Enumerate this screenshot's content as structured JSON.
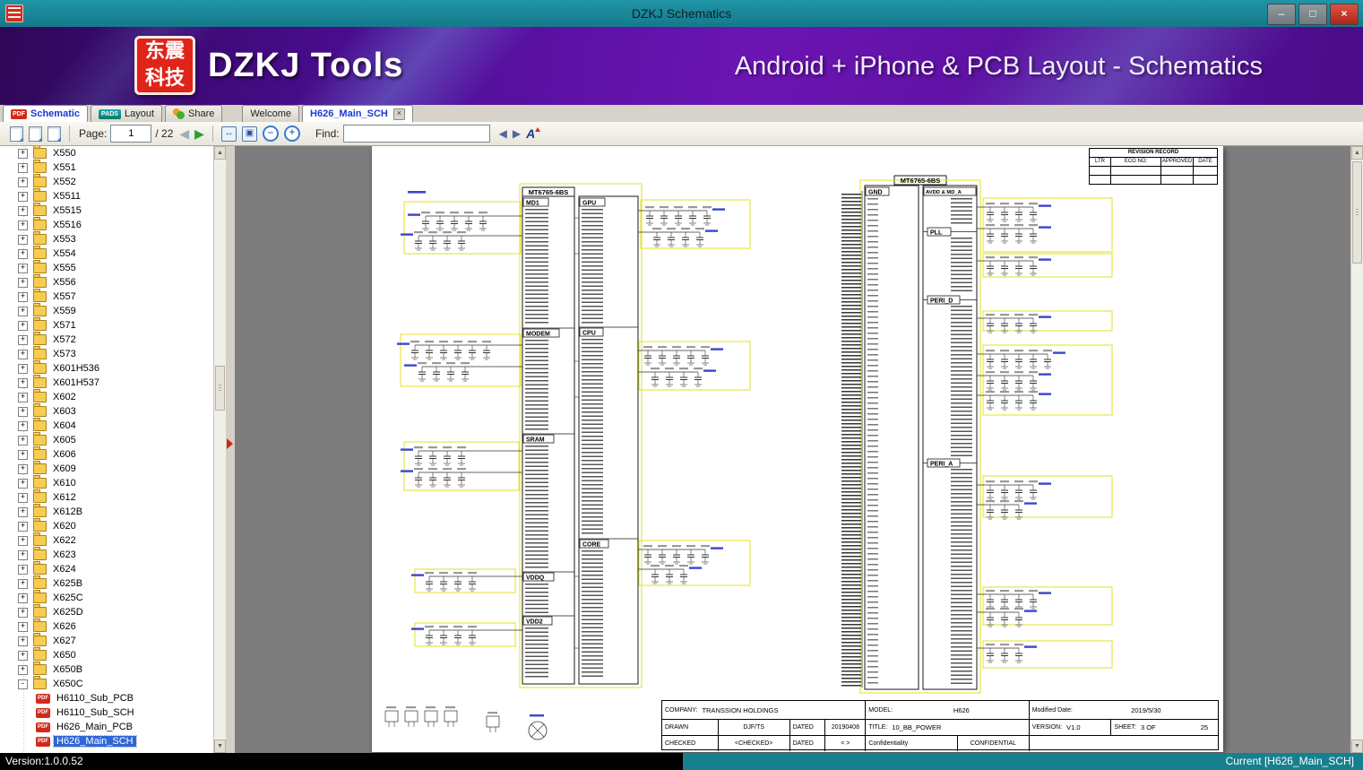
{
  "window": {
    "title": "DZKJ Schematics"
  },
  "banner": {
    "logo_line1": "东震",
    "logo_line2": "科技",
    "app_name": "DZKJ Tools",
    "tagline": "Android + iPhone & PCB Layout - Schematics"
  },
  "tabs": {
    "mode": [
      {
        "label": "Schematic"
      },
      {
        "label": "Layout"
      },
      {
        "label": "Share"
      }
    ],
    "docs": [
      {
        "label": "Welcome"
      },
      {
        "label": "H626_Main_SCH"
      }
    ]
  },
  "toolbar": {
    "page_label": "Page:",
    "page_value": "1",
    "page_total": "/ 22",
    "find_label": "Find:",
    "find_value": ""
  },
  "sidebar": {
    "folders": [
      "X550",
      "X551",
      "X552",
      "X5511",
      "X5515",
      "X5516",
      "X553",
      "X554",
      "X555",
      "X556",
      "X557",
      "X559",
      "X571",
      "X572",
      "X573",
      "X601H536",
      "X601H537",
      "X602",
      "X603",
      "X604",
      "X605",
      "X606",
      "X609",
      "X610",
      "X612",
      "X612B",
      "X620",
      "X622",
      "X623",
      "X624",
      "X625B",
      "X625C",
      "X625D",
      "X626",
      "X627",
      "X650",
      "X650B",
      "X650C"
    ],
    "expanded_folder": "X650C",
    "files": [
      "H6110_Sub_PCB",
      "H6110_Sub_SCH",
      "H626_Main_PCB",
      "H626_Main_SCH"
    ],
    "selected_file": "H626_Main_SCH"
  },
  "schematic": {
    "chip_name": "MT6765-6BS",
    "blocks": {
      "md1": "MD1",
      "gpu": "GPU",
      "modem": "MODEM",
      "cpu": "CPU",
      "sram": "SRAM",
      "core": "CORE",
      "vddq": "VDDQ",
      "vdd2": "VDD2",
      "gnd": "GND",
      "avdd": "AVDD & MD_A",
      "pll": "PLL",
      "peri_d": "PERI_D",
      "peri_a": "PERI_A"
    },
    "revision": {
      "title": "REVISION RECORD",
      "columns": [
        "LTR",
        "ECO NO:",
        "APPROVED",
        "DATE"
      ]
    },
    "titleblock": {
      "company_label": "COMPANY:",
      "company_value": "TRANSSION HOLDINGS",
      "model_label": "MODEL:",
      "model_value": "H626",
      "modified_label": "Modified Date:",
      "modified_value": "2019/5/30",
      "drawn_label": "DRAWN",
      "drawn_value": "DJF/TS",
      "dated_label": "DATED",
      "dated_value": "20190408",
      "title_label": "TITLE:",
      "title_value": "10_BB_POWER",
      "version_label": "VERSION:",
      "version_value": "V1.0",
      "sheet_label": "SHEET:",
      "sheet_value": "3 OF",
      "sheet_total": "25",
      "checked_label": "CHECKED",
      "checked_value": "<CHECKED>",
      "dated2_label": "DATED",
      "dated2_value": "< >",
      "conf_label": "Confidentiality",
      "conf_value": "CONFIDENTIAL"
    }
  },
  "statusbar": {
    "version": "Version:1.0.0.52",
    "current": "Current [H626_Main_SCH]"
  },
  "icons": {
    "pdf_badge": "PDF",
    "pads_badge": "PADS",
    "minimize": "–",
    "maximize": "□",
    "close": "×",
    "tab_close": "×",
    "expander_open": "-",
    "expander_closed": "+",
    "prev_arrow": "◀",
    "next_arrow": "▶",
    "fit_width": "↔",
    "fit_page": "▣",
    "zoom_out": "–",
    "zoom_in": "+",
    "font_adjust": "A",
    "scroll_up": "▲",
    "scroll_down": "▼"
  },
  "colors": {
    "titlebar_teal": "#1a8191",
    "banner_purple": "#5c10a0",
    "brand_red": "#e02418",
    "selection_blue": "#2e66d8",
    "close_red": "#b02a1c"
  }
}
